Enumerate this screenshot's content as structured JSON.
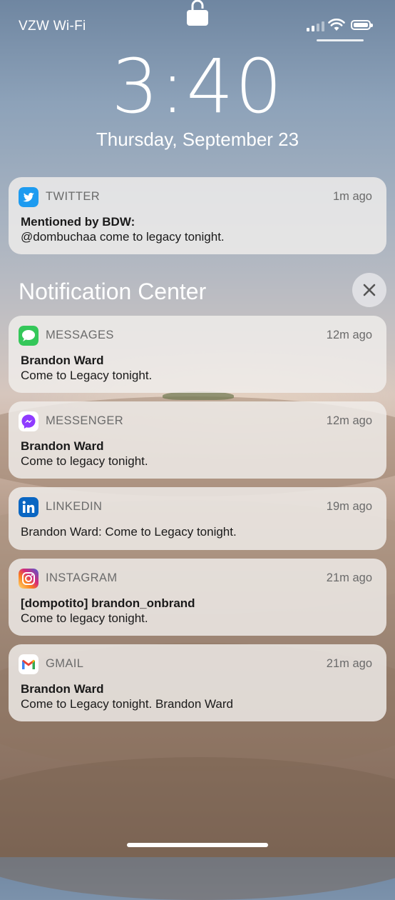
{
  "status_bar": {
    "carrier": "VZW Wi-Fi"
  },
  "lock": {
    "time": "3:40",
    "date": "Thursday, September 23"
  },
  "pinned": {
    "app": "TWITTER",
    "ago": "1m ago",
    "title": "Mentioned by BDW:",
    "body": "@dombuchaa come to legacy tonight.",
    "icon": "twitter-icon",
    "color": "#1d9bf0"
  },
  "notification_center": {
    "title": "Notification Center"
  },
  "notifications": [
    {
      "app": "MESSAGES",
      "ago": "12m ago",
      "title": "Brandon Ward",
      "body": "Come to Legacy tonight.",
      "icon": "messages-icon",
      "color": "#34c759"
    },
    {
      "app": "MESSENGER",
      "ago": "12m ago",
      "title": "Brandon Ward",
      "body": "Come to legacy tonight.",
      "icon": "messenger-icon",
      "color": "#a033ff"
    },
    {
      "app": "LINKEDIN",
      "ago": "19m ago",
      "title": "",
      "body": "Brandon Ward: Come to Legacy tonight.",
      "icon": "linkedin-icon",
      "color": "#0a66c2"
    },
    {
      "app": "INSTAGRAM",
      "ago": "21m ago",
      "title": "[dompotito] brandon_onbrand",
      "body": "Come to legacy tonight.",
      "icon": "instagram-icon",
      "color": "#e1306c"
    },
    {
      "app": "GMAIL",
      "ago": "21m ago",
      "title": "Brandon Ward",
      "body": "Come to Legacy tonight. Brandon Ward",
      "icon": "gmail-icon",
      "color": "#ea4335"
    }
  ]
}
